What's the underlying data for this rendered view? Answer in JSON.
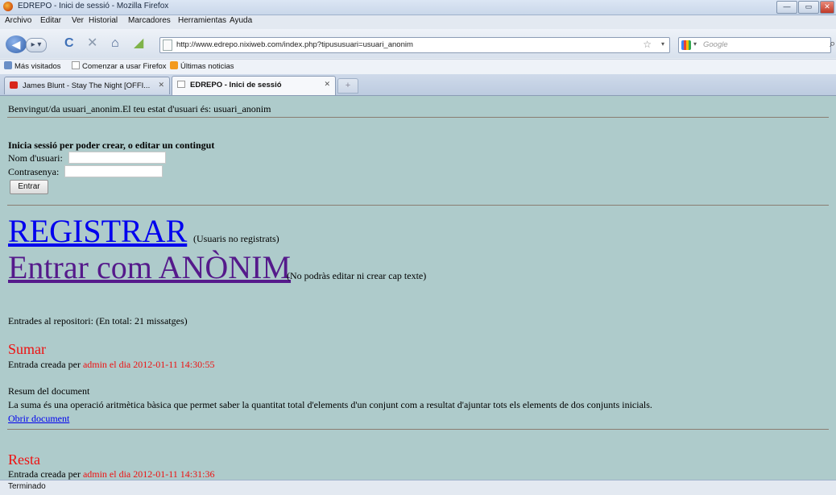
{
  "window": {
    "title": "EDREPO - Inici de sessió - Mozilla Firefox",
    "minimize": "—",
    "maximize": "▭",
    "close": "✕"
  },
  "menu": [
    "Archivo",
    "Editar",
    "Ver",
    "Historial",
    "Marcadores",
    "Herramientas",
    "Ayuda"
  ],
  "nav": {
    "url": "http://www.edrepo.nixiweb.com/index.php?tipususuari=usuari_anonim",
    "search_placeholder": "Google"
  },
  "bookmarks": [
    "Más visitados",
    "Comenzar a usar Firefox",
    "Últimas noticias"
  ],
  "tabs": [
    {
      "label": "James Blunt - Stay The Night [OFFI...",
      "close": "✕"
    },
    {
      "label": "EDREPO - Inici de sessió",
      "close": "✕"
    }
  ],
  "content": {
    "welcome": "Benvingut/da usuari_anonim.El teu estat d'usuari és: usuari_anonim",
    "login_heading": "Inicia sessió per poder crear, o editar un contingut",
    "username_label": "Nom d'usuari:",
    "password_label": "Contrasenya:",
    "login_button": "Entrar",
    "register_link": "REGISTRAR",
    "register_note": "(Usuaris no registrats)",
    "anon_link": "Entrar com ANÒNIM",
    "anon_note": "(No podràs editar ni crear cap texte)",
    "entries_count": "Entrades al repositori: (En total: 21 missatges)",
    "entries": [
      {
        "title": "Sumar",
        "created_by_text": "Entrada creada per",
        "author_date": "admin el dia 2012-01-11 14:30:55",
        "summary_label": "Resum del document",
        "summary": "La suma és una operació aritmètica bàsica que permet saber la quantitat total d'elements d'un conjunt com a resultat d'ajuntar tots els elements de dos conjunts inicials.",
        "open_link": "Obrir document"
      },
      {
        "title": "Resta",
        "created_by_text": "Entrada creada per",
        "author_date": "admin el dia 2012-01-11 14:31:36"
      }
    ]
  },
  "status": "Terminado",
  "colors": {
    "page_bg": "#aecbcb",
    "link_blue": "#0000ee",
    "link_visited": "#551a8b",
    "accent_red": "#ee1111"
  }
}
